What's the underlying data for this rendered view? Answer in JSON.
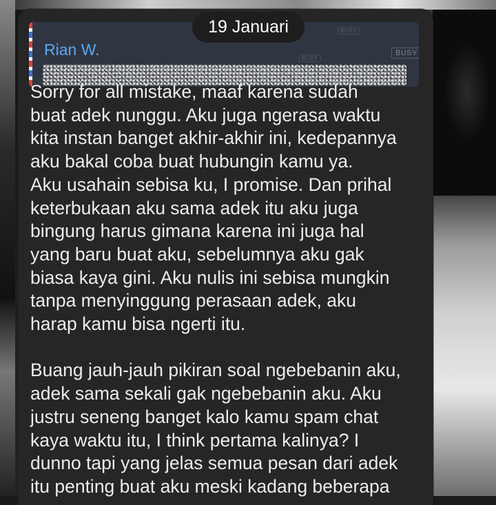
{
  "date_pill": "19 Januari",
  "reply": {
    "sender_name": "Rian W.",
    "tag": "BUSY"
  },
  "message": {
    "lines": [
      "Sorry for all mistake, maaf karena sudah",
      "buat adek nunggu. Aku juga ngerasa waktu",
      "kita instan banget akhir-akhir ini, kedepannya",
      "aku bakal coba buat hubungin kamu ya.",
      "Aku usahain sebisa ku, I promise. Dan prihal",
      "keterbukaan aku sama adek itu aku juga",
      "bingung harus gimana karena ini juga hal",
      "yang baru buat aku, sebelumnya aku gak",
      "biasa kaya gini. Aku nulis ini sebisa mungkin",
      "tanpa menyinggung perasaan adek, aku",
      "harap kamu bisa ngerti itu.",
      "",
      "Buang jauh-jauh pikiran soal ngebebanin aku,",
      "adek sama sekali gak ngebebanin aku. Aku",
      "justru seneng banget kalo kamu spam chat",
      "kaya waktu itu, I think pertama kalinya? I",
      "dunno tapi yang jelas semua pesan dari adek",
      "itu penting buat aku meski kadang beberapa"
    ]
  },
  "colors": {
    "bubble": "#262626",
    "reply_block": "#2f3642",
    "sender_name": "#5aa8f0",
    "text": "#ececec"
  }
}
